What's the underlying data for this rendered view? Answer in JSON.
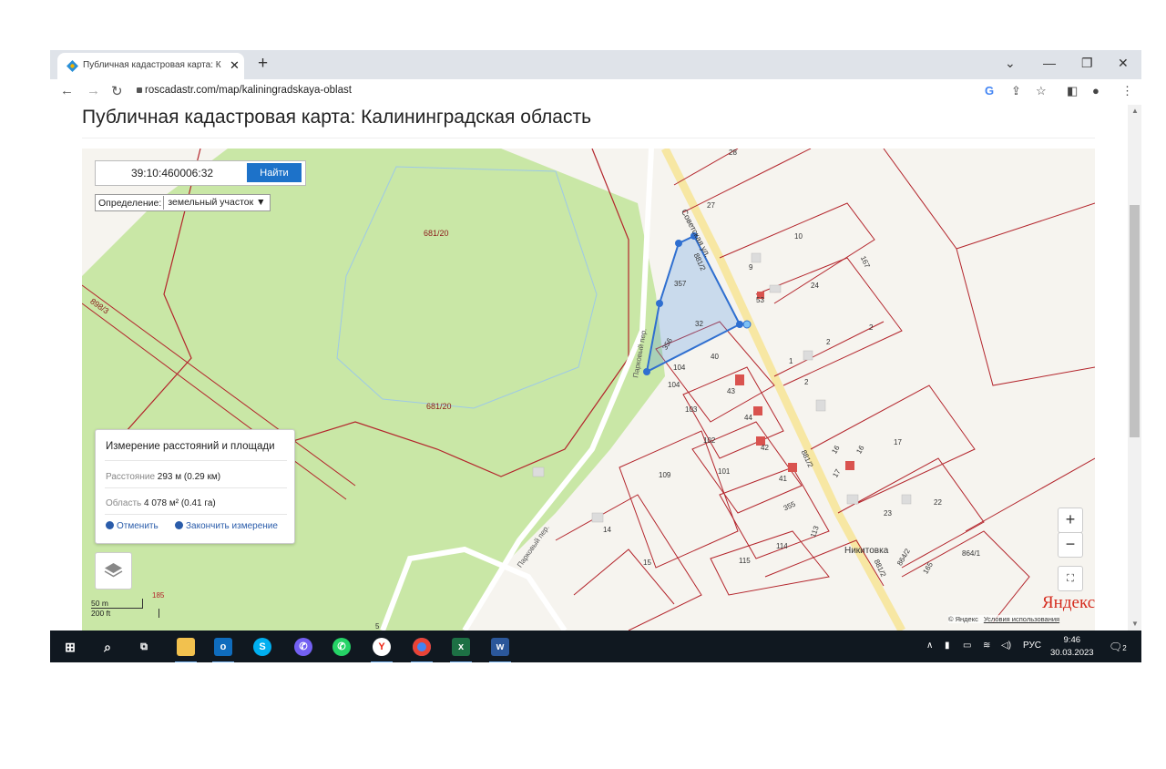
{
  "browser": {
    "tab_title": "Публичная кадастровая карта: К",
    "tab_close": "✕",
    "new_tab": "+",
    "url": "roscadastr.com/map/kaliningradskaya-oblast"
  },
  "page": {
    "title": "Публичная кадастровая карта: Калининградская область"
  },
  "search": {
    "value": "39:10:460006:32",
    "button_label": "Найти"
  },
  "definition": {
    "label": "Определение:",
    "selected": "земельный участок"
  },
  "measure": {
    "title": "Измерение расстояний и площади",
    "distance_label": "Расстояние",
    "distance_value": "293 м (0.29 км)",
    "area_label": "Область",
    "area_value": "4 078 м² (0.41 га)",
    "cancel_label": "Отменить",
    "finish_label": "Закончить измерение"
  },
  "map_controls": {
    "zoom_in": "+",
    "zoom_out": "−",
    "scale_m": "50 m",
    "scale_ft": "200 ft"
  },
  "attribution": {
    "brand": "Яндекс",
    "copyright": "© Яндекс",
    "terms": "Условия использования"
  },
  "map_labels": {
    "parcel_681_20": "681/20",
    "parcel_898_3": "898/3",
    "street_sovetskaya": "Советская ул.",
    "street_parkovy": "Парковый пер.",
    "village": "Никитовка",
    "parcels": [
      "357",
      "32",
      "356",
      "104",
      "104",
      "103",
      "102",
      "101",
      "109",
      "40",
      "43",
      "44",
      "42",
      "41",
      "53",
      "9",
      "27",
      "10",
      "24",
      "167",
      "2",
      "2",
      "1",
      "2",
      "17",
      "16",
      "16",
      "17",
      "22",
      "23",
      "355",
      "113",
      "114",
      "115",
      "15",
      "14",
      "165",
      "864/2",
      "864/1",
      "881/2",
      "881/2",
      "881/2",
      "5",
      "185",
      "28"
    ]
  },
  "taskbar": {
    "lang": "РУС",
    "time": "9:46",
    "date": "30.03.2023",
    "notifications": "2"
  },
  "colors": {
    "parcel_line": "#b3242b",
    "forest": "#c9e7a6",
    "selection": "#2f6fd0",
    "taskbar": "#101820",
    "accent": "#1d72c9"
  }
}
